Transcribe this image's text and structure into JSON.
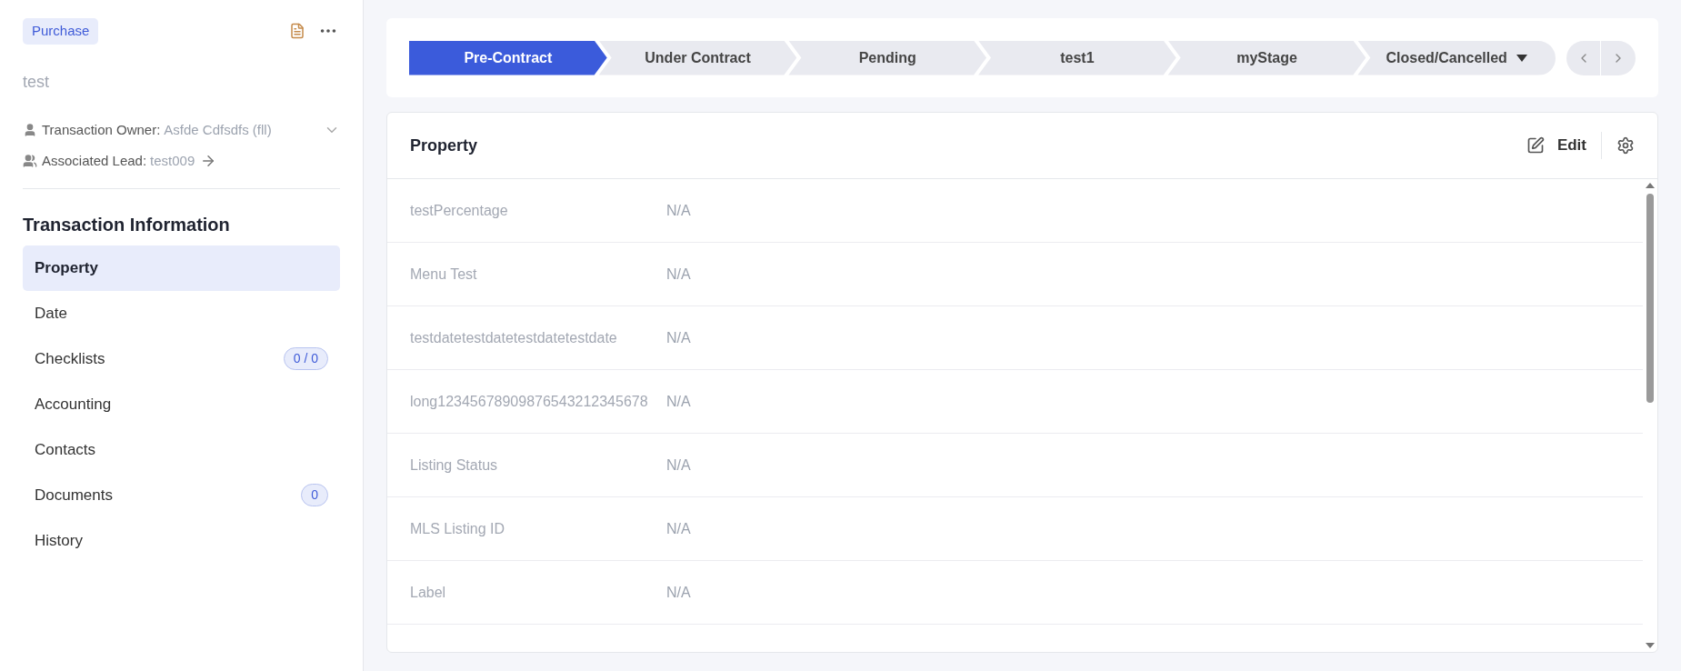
{
  "sidebar": {
    "badge": "Purchase",
    "title": "test",
    "owner_label": "Transaction Owner:",
    "owner_value": "Asfde Cdfsdfs (fll)",
    "lead_label": "Associated Lead:",
    "lead_value": "test009",
    "section_title": "Transaction Information",
    "items": [
      {
        "label": "Property",
        "selected": true
      },
      {
        "label": "Date",
        "selected": false
      },
      {
        "label": "Checklists",
        "selected": false,
        "count": "0 / 0"
      },
      {
        "label": "Accounting",
        "selected": false
      },
      {
        "label": "Contacts",
        "selected": false
      },
      {
        "label": "Documents",
        "selected": false,
        "count": "0"
      },
      {
        "label": "History",
        "selected": false
      }
    ]
  },
  "stages": [
    {
      "label": "Pre-Contract",
      "selected": true
    },
    {
      "label": "Under Contract",
      "selected": false
    },
    {
      "label": "Pending",
      "selected": false
    },
    {
      "label": "test1",
      "selected": false
    },
    {
      "label": "myStage",
      "selected": false
    },
    {
      "label": "Closed/Cancelled",
      "selected": false,
      "kind": "dropdown"
    }
  ],
  "panel": {
    "title": "Property",
    "edit_label": "Edit",
    "rows": [
      {
        "label": "testPercentage",
        "value": "N/A"
      },
      {
        "label": "Menu Test",
        "value": "N/A"
      },
      {
        "label": "testdatetestdatetestdatetestdate",
        "value": "N/A"
      },
      {
        "label": "long12345678909876543212345678",
        "value": "N/A"
      },
      {
        "label": "Listing Status",
        "value": "N/A"
      },
      {
        "label": "MLS Listing ID",
        "value": "N/A"
      },
      {
        "label": "Label",
        "value": "N/A"
      }
    ]
  }
}
